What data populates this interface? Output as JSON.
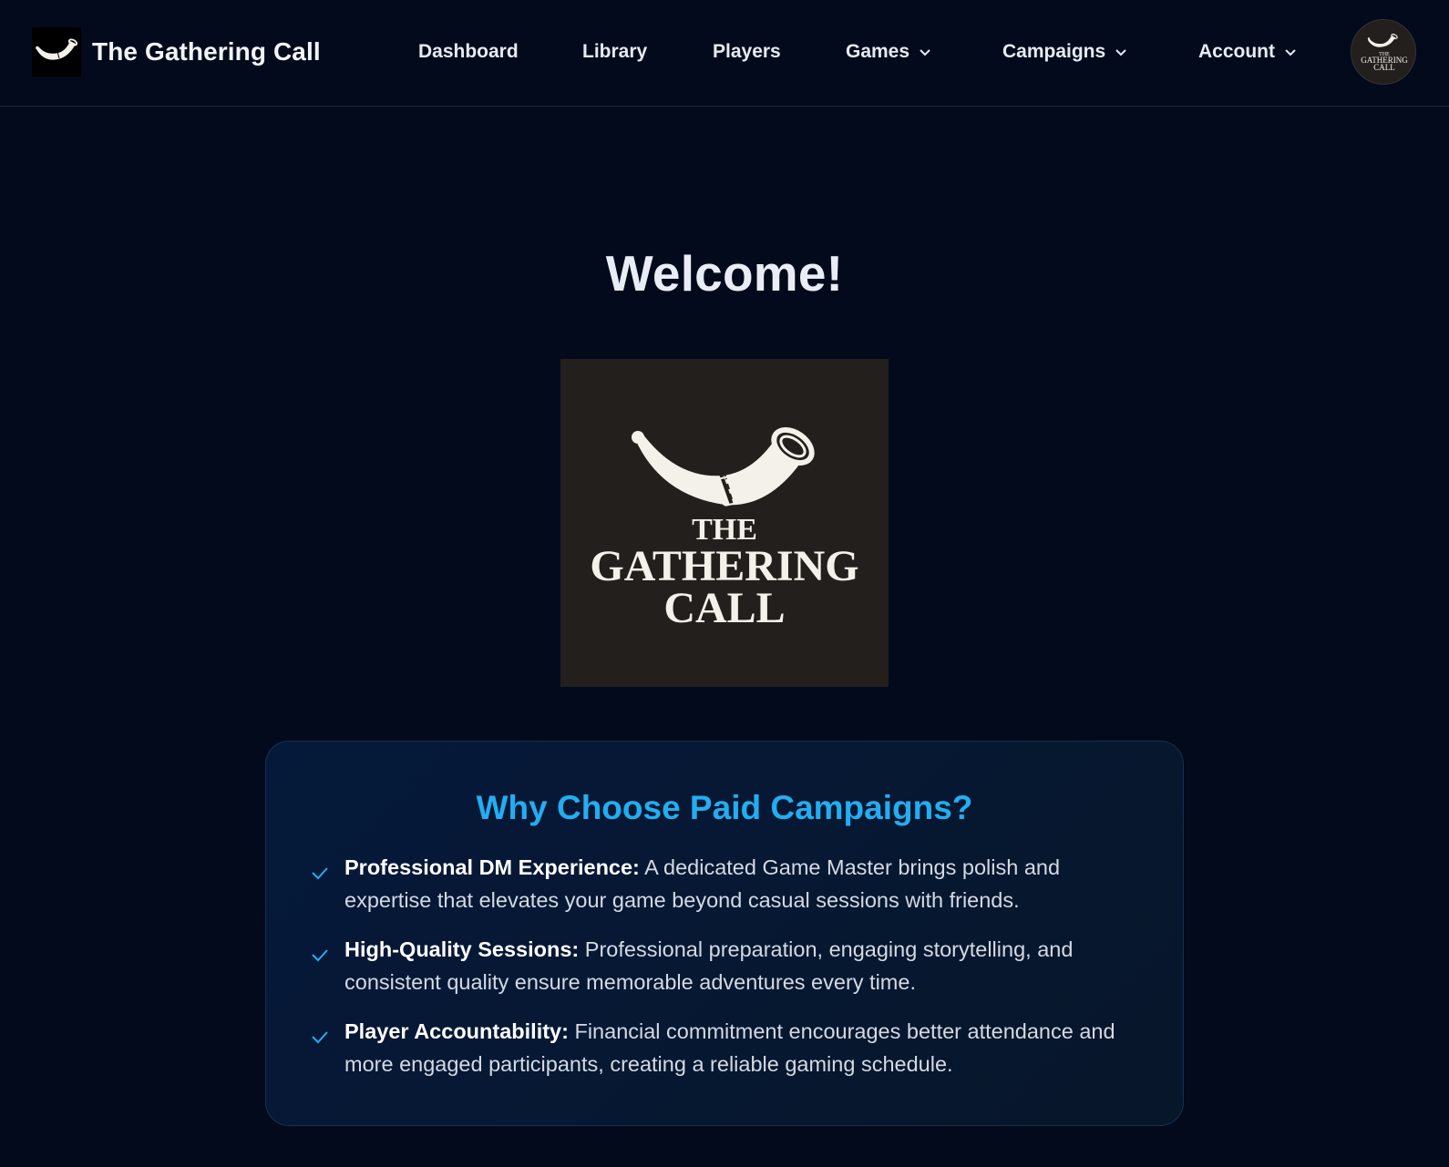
{
  "brand": {
    "name": "The Gathering Call",
    "logo_icon": "horn-icon"
  },
  "nav": {
    "items": [
      {
        "label": "Dashboard",
        "dropdown": false
      },
      {
        "label": "Library",
        "dropdown": false
      },
      {
        "label": "Players",
        "dropdown": false
      },
      {
        "label": "Games",
        "dropdown": true
      },
      {
        "label": "Campaigns",
        "dropdown": true
      },
      {
        "label": "Account",
        "dropdown": true
      }
    ]
  },
  "avatar": {
    "logo_lines": [
      "THE",
      "GATHERING",
      "CALL"
    ]
  },
  "main": {
    "welcome": "Welcome!",
    "hero_logo_lines": [
      "THE",
      "GATHERING",
      "CALL"
    ]
  },
  "benefits_card": {
    "title": "Why Choose Paid Campaigns?",
    "items": [
      {
        "heading": "Professional DM Experience:",
        "text": "A dedicated Game Master brings polish and expertise that elevates your game beyond casual sessions with friends."
      },
      {
        "heading": "High-Quality Sessions:",
        "text": "Professional preparation, engaging storytelling, and consistent quality ensure memorable adventures every time."
      },
      {
        "heading": "Player Accountability:",
        "text": "Financial commitment encourages better attendance and more engaged participants, creating a reliable gaming schedule."
      }
    ]
  },
  "colors": {
    "background": "#030a1c",
    "accent": "#22aef0",
    "card_border": "#17304e",
    "logo_bg": "#231f1d"
  }
}
